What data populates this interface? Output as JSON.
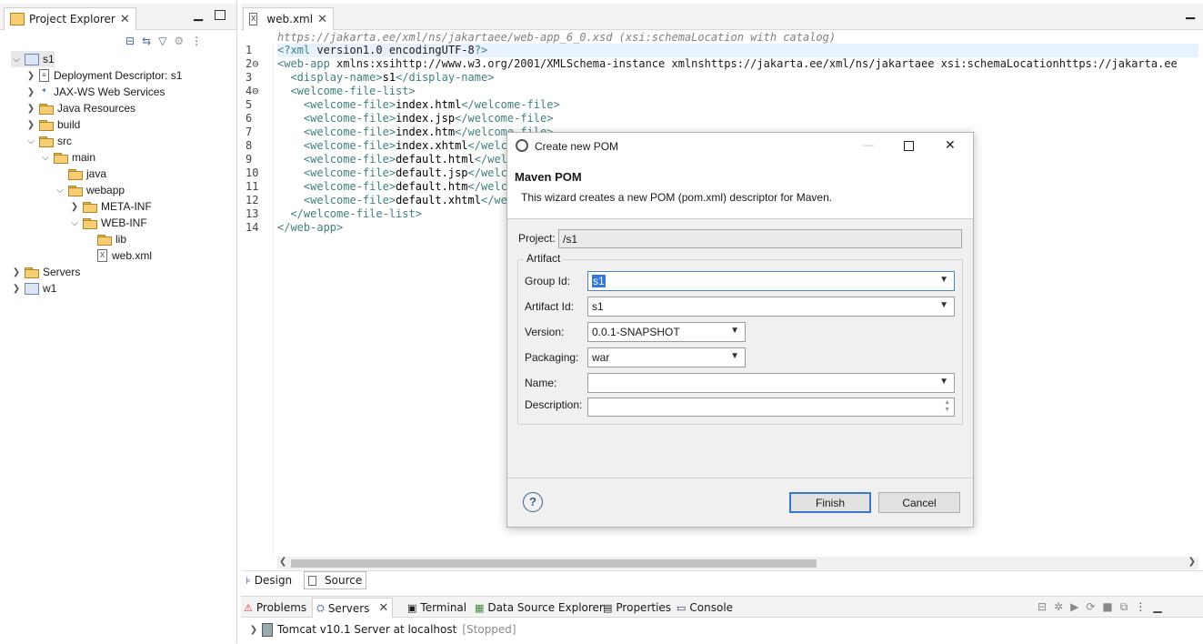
{
  "explorer": {
    "tab_label": "Project Explorer",
    "tree": [
      {
        "label": "s1",
        "depth": 0,
        "chev": "open",
        "icon": "project"
      },
      {
        "label": "Deployment Descriptor: s1",
        "depth": 1,
        "chev": "closed",
        "icon": "descriptor"
      },
      {
        "label": "JAX-WS Web Services",
        "depth": 1,
        "chev": "closed",
        "icon": "ws"
      },
      {
        "label": "Java Resources",
        "depth": 1,
        "chev": "closed",
        "icon": "jres"
      },
      {
        "label": "build",
        "depth": 1,
        "chev": "closed",
        "icon": "folder"
      },
      {
        "label": "src",
        "depth": 1,
        "chev": "open",
        "icon": "folder"
      },
      {
        "label": "main",
        "depth": 2,
        "chev": "open",
        "icon": "folder"
      },
      {
        "label": "java",
        "depth": 3,
        "chev": "none",
        "icon": "folder"
      },
      {
        "label": "webapp",
        "depth": 3,
        "chev": "open",
        "icon": "folder"
      },
      {
        "label": "META-INF",
        "depth": 4,
        "chev": "closed",
        "icon": "folder"
      },
      {
        "label": "WEB-INF",
        "depth": 4,
        "chev": "open",
        "icon": "folder"
      },
      {
        "label": "lib",
        "depth": 5,
        "chev": "none",
        "icon": "folder"
      },
      {
        "label": "web.xml",
        "depth": 5,
        "chev": "none",
        "icon": "xmlfile"
      },
      {
        "label": "Servers",
        "depth": 0,
        "chev": "closed",
        "icon": "folder"
      },
      {
        "label": "w1",
        "depth": 0,
        "chev": "closed",
        "icon": "project"
      }
    ]
  },
  "editor": {
    "tab_label": "web.xml",
    "schema_hint": "https://jakarta.ee/xml/ns/jakartaee/web-app_6_0.xsd (xsi:schemaLocation with catalog)",
    "line_numbers": [
      "1",
      "2⊖",
      "3",
      "4⊖",
      "5",
      "6",
      "7",
      "8",
      "9",
      "10",
      "11",
      "12",
      "13",
      "14"
    ],
    "lines": [
      "<?xml version=\"1.0\" encoding=\"UTF-8\"?>",
      "<web-app xmlns:xsi=\"http://www.w3.org/2001/XMLSchema-instance\" xmlns=\"https://jakarta.ee/xml/ns/jakartaee\" xsi:schemaLocation=\"https://jakarta.ee",
      "  <display-name>s1</display-name>",
      "  <welcome-file-list>",
      "    <welcome-file>index.html</welcome-file>",
      "    <welcome-file>index.jsp</welcome-file>",
      "    <welcome-file>index.htm</welcome-file>",
      "    <welcome-file>index.xhtml</welcome-file>",
      "    <welcome-file>default.html</welcome-file>",
      "    <welcome-file>default.jsp</welcome-file>",
      "    <welcome-file>default.htm</welcome-file>",
      "    <welcome-file>default.xhtml</welcome-file>",
      "  </welcome-file-list>",
      "</web-app>"
    ],
    "bottom_tabs": {
      "design": "Design",
      "source": "Source"
    }
  },
  "dialog": {
    "title": "Create new POM",
    "heading": "Maven POM",
    "description": "This wizard creates a new POM (pom.xml) descriptor for Maven.",
    "project_label": "Project:",
    "project_value": "/s1",
    "group_legend": "Artifact",
    "group_id_label": "Group Id:",
    "group_id_value": "s1",
    "artifact_id_label": "Artifact Id:",
    "artifact_id_value": "s1",
    "version_label": "Version:",
    "version_value": "0.0.1-SNAPSHOT",
    "packaging_label": "Packaging:",
    "packaging_value": "war",
    "name_label": "Name:",
    "name_value": "",
    "description_label": "Description:",
    "description_value": "",
    "finish": "Finish",
    "cancel": "Cancel",
    "help_glyph": "?"
  },
  "bottom_panel": {
    "tabs": [
      "Problems",
      "Servers",
      "Terminal",
      "Data Source Explorer",
      "Properties",
      "Console"
    ],
    "server_name": "Tomcat v10.1 Server at localhost",
    "server_status": "[Stopped]"
  }
}
